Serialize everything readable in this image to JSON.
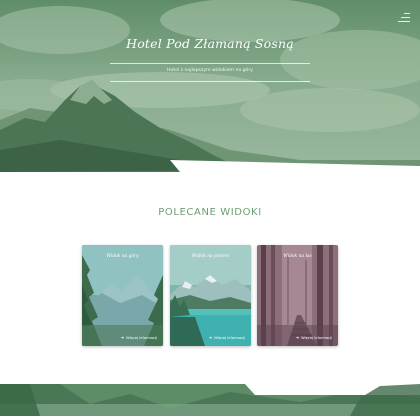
{
  "hero": {
    "title": "Hotel Pod Złamaną Sosną",
    "subtitle": "Hotel z najlepszym widokiem na góry"
  },
  "menu": {
    "icon": "hamburger-icon"
  },
  "featured": {
    "heading": "POLECANE WIDOKI",
    "cards": [
      {
        "title": "Widok na góry",
        "more_label": "Więcej informacji",
        "icon": "arrow-right-icon"
      },
      {
        "title": "Widok na jezioro",
        "more_label": "Więcej informacji",
        "icon": "arrow-right-icon"
      },
      {
        "title": "Widok na las",
        "more_label": "Więcej informacji",
        "icon": "arrow-right-icon"
      }
    ]
  },
  "colors": {
    "accent": "#6d9e72",
    "hero_overlay": "#4f7f58"
  }
}
